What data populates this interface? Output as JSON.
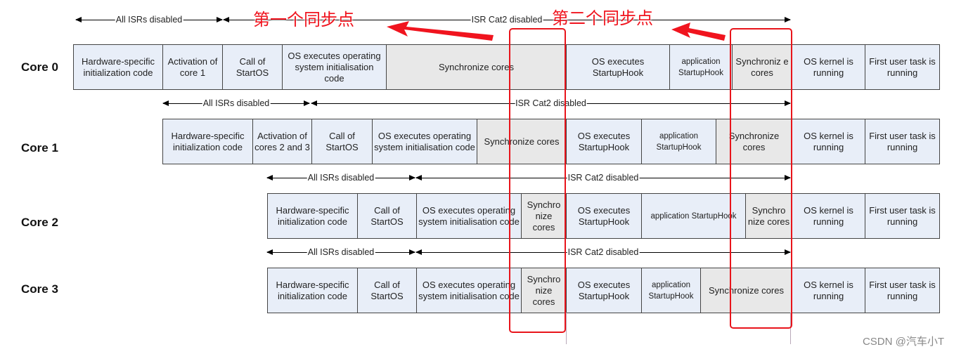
{
  "annotations": {
    "sync1": "第一个同步点",
    "sync2": "第二个同步点",
    "color": "#e8141b"
  },
  "watermark": "CSDN @汽车小T",
  "colors": {
    "task": "#e8eef8",
    "sync": "#e8e8e8"
  },
  "rows": [
    {
      "core": "Core  0",
      "isr_all": "All ISRs disabled",
      "isr_cat2": "ISR Cat2 disabled",
      "cells": [
        {
          "label": "Hardware-specific initialization code"
        },
        {
          "label": "Activation of  core 1"
        },
        {
          "label": "Call of StartOS"
        },
        {
          "label": "OS executes operating system initialisation code"
        },
        {
          "label": "Synchronize cores",
          "sync": true
        },
        {
          "label": "OS executes StartupHook"
        },
        {
          "label": "application StartupHook",
          "small": true
        },
        {
          "label": "Synchroniz e cores",
          "sync": true
        },
        {
          "label": "OS kernel is running"
        },
        {
          "label": "First user task is running"
        }
      ]
    },
    {
      "core": "Core  1",
      "isr_all": "All ISRs disabled",
      "isr_cat2": "ISR Cat2 disabled",
      "cells": [
        {
          "label": "Hardware-specific initialization code"
        },
        {
          "label": "Activation of cores 2 and 3"
        },
        {
          "label": "Call of StartOS"
        },
        {
          "label": "OS executes operating system initialisation code"
        },
        {
          "label": "Synchronize cores",
          "sync": true
        },
        {
          "label": "OS executes StartupHook"
        },
        {
          "label": "application StartupHook",
          "small": true
        },
        {
          "label": "Synchronize cores",
          "sync": true
        },
        {
          "label": "OS kernel is running"
        },
        {
          "label": "First user task is running"
        }
      ]
    },
    {
      "core": "Core  2",
      "isr_all": "All ISRs disabled",
      "isr_cat2": "ISR Cat2 disabled",
      "cells": [
        {
          "label": "Hardware-specific initialization code"
        },
        {
          "label": "Call of StartOS"
        },
        {
          "label": "OS executes operating system initialisation code"
        },
        {
          "label": "Synchro nize cores",
          "sync": true
        },
        {
          "label": "OS executes StartupHook"
        },
        {
          "label": "application StartupHook",
          "small": true
        },
        {
          "label": "Synchro nize cores",
          "sync": true
        },
        {
          "label": "OS kernel is running"
        },
        {
          "label": "First user task is running"
        }
      ]
    },
    {
      "core": "Core  3",
      "isr_all": "All ISRs disabled",
      "isr_cat2": "ISR Cat2 disabled",
      "cells": [
        {
          "label": "Hardware-specific initialization code"
        },
        {
          "label": "Call of StartOS"
        },
        {
          "label": "OS executes operating system initialisation code"
        },
        {
          "label": "Synchro nize cores",
          "sync": true
        },
        {
          "label": "OS executes StartupHook"
        },
        {
          "label": "application StartupHook",
          "small": true
        },
        {
          "label": "Synchronize cores",
          "sync": true
        },
        {
          "label": "OS kernel is running"
        },
        {
          "label": "First user task is running"
        }
      ]
    }
  ]
}
